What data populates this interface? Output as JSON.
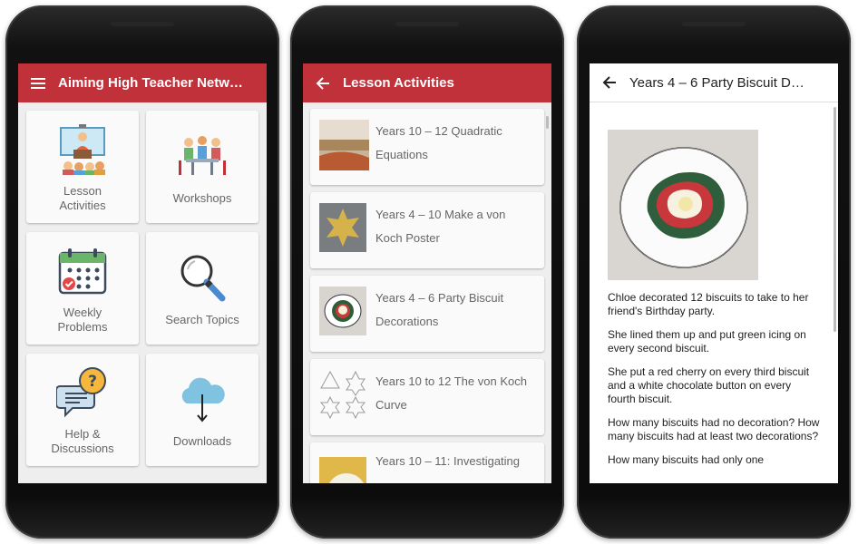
{
  "phone1": {
    "title": "Aiming High Teacher Netw…",
    "tiles": [
      {
        "label": "Lesson\nActivities",
        "icon": "presenter-icon"
      },
      {
        "label": "Workshops",
        "icon": "meeting-icon"
      },
      {
        "label": "Weekly\nProblems",
        "icon": "calendar-icon"
      },
      {
        "label": "Search Topics",
        "icon": "search-icon"
      },
      {
        "label": "Help &\nDiscussions",
        "icon": "chat-help-icon"
      },
      {
        "label": "Downloads",
        "icon": "cloud-download-icon"
      }
    ]
  },
  "phone2": {
    "title": "Lesson Activities",
    "items": [
      {
        "title": "Years 10 – 12 Quadratic Equations"
      },
      {
        "title": "Years 4 – 10 Make a von Koch Poster"
      },
      {
        "title": "Years 4 – 6 Party Biscuit Decorations"
      },
      {
        "title": "Years 10 to 12 The von Koch Curve"
      },
      {
        "title": "Years 10 – 11: Investigating"
      }
    ]
  },
  "phone3": {
    "title": "Years 4 – 6 Party Biscuit D…",
    "paragraphs": [
      "Chloe decorated 12 biscuits to take to her friend's Birthday party.",
      "She lined them up and put green icing on every second biscuit.",
      "She put a red cherry on every third biscuit and a white chocolate button on every fourth biscuit.",
      "How many biscuits had no decoration? How many biscuits had at least two decorations?",
      "How many biscuits had only one"
    ]
  },
  "colors": {
    "appbar": "#c0313a",
    "tile_bg": "#fafafa",
    "screen_bg": "#eeeeee"
  }
}
